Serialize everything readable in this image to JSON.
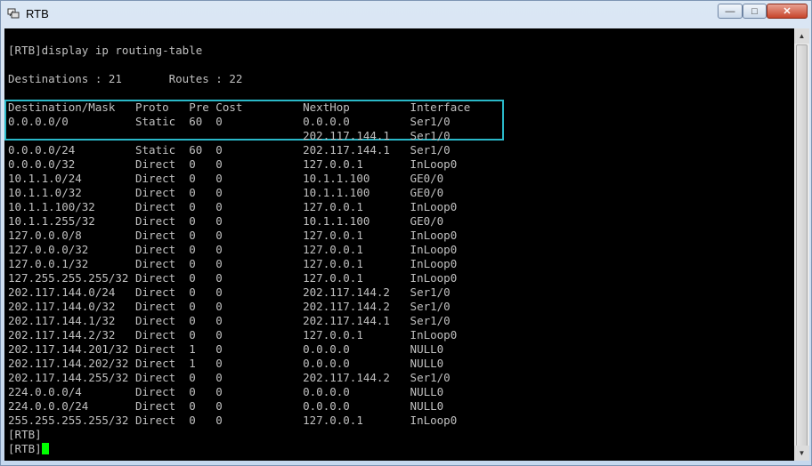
{
  "window": {
    "title": "RTB",
    "controls": {
      "minimize": "—",
      "maximize": "□",
      "close": "✕"
    }
  },
  "terminal": {
    "lines": [
      "[RTB]display ip routing-table",
      "",
      "Destinations : 21       Routes : 22",
      "",
      "Destination/Mask   Proto   Pre Cost         NextHop         Interface",
      "0.0.0.0/0          Static  60  0            0.0.0.0         Ser1/0",
      "                                            202.117.144.1   Ser1/0",
      "0.0.0.0/24         Static  60  0            202.117.144.1   Ser1/0",
      "0.0.0.0/32         Direct  0   0            127.0.0.1       InLoop0",
      "10.1.1.0/24        Direct  0   0            10.1.1.100      GE0/0",
      "10.1.1.0/32        Direct  0   0            10.1.1.100      GE0/0",
      "10.1.1.100/32      Direct  0   0            127.0.0.1       InLoop0",
      "10.1.1.255/32      Direct  0   0            10.1.1.100      GE0/0",
      "127.0.0.0/8        Direct  0   0            127.0.0.1       InLoop0",
      "127.0.0.0/32       Direct  0   0            127.0.0.1       InLoop0",
      "127.0.0.1/32       Direct  0   0            127.0.0.1       InLoop0",
      "127.255.255.255/32 Direct  0   0            127.0.0.1       InLoop0",
      "202.117.144.0/24   Direct  0   0            202.117.144.2   Ser1/0",
      "202.117.144.0/32   Direct  0   0            202.117.144.2   Ser1/0",
      "202.117.144.1/32   Direct  0   0            202.117.144.1   Ser1/0",
      "202.117.144.2/32   Direct  0   0            127.0.0.1       InLoop0",
      "202.117.144.201/32 Direct  1   0            0.0.0.0         NULL0",
      "202.117.144.202/32 Direct  1   0            0.0.0.0         NULL0",
      "202.117.144.255/32 Direct  0   0            202.117.144.2   Ser1/0",
      "224.0.0.0/4        Direct  0   0            0.0.0.0         NULL0",
      "224.0.0.0/24       Direct  0   0            0.0.0.0         NULL0",
      "255.255.255.255/32 Direct  0   0            127.0.0.1       InLoop0",
      "[RTB]",
      "[RTB]"
    ]
  },
  "colors": {
    "terminal_bg": "#000000",
    "terminal_text": "#c0c0c0",
    "cursor": "#00ff00",
    "highlight_box": "#2ab8c8"
  },
  "icons": {
    "app": "terminal-app-icon",
    "scroll_up": "arrow-up-icon",
    "scroll_down": "arrow-down-icon"
  }
}
